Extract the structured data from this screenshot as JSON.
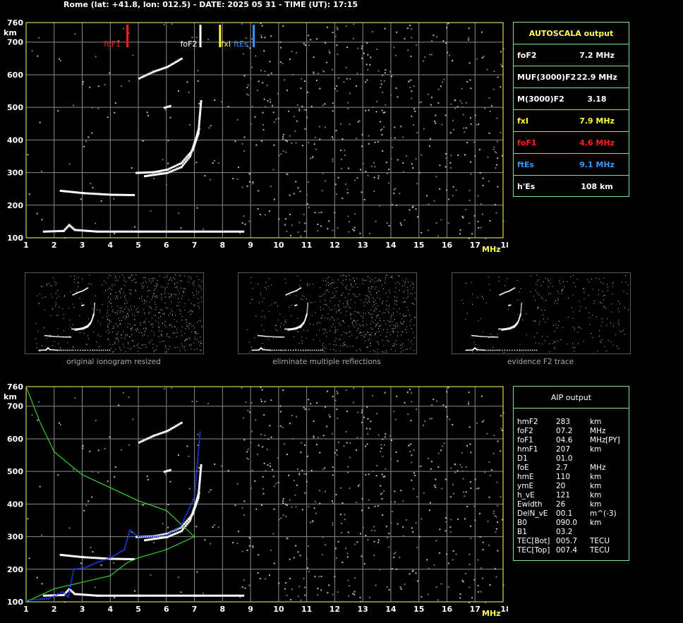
{
  "header": "Rome (lat: +41.8, lon: 012.5) - DATE: 2025 05 31 - TIME (UT): 17:15",
  "axes": {
    "y_ticks": [
      "760",
      "700",
      "600",
      "500",
      "400",
      "300",
      "200",
      "100"
    ],
    "y_unit": "km",
    "x_ticks": [
      "1",
      "2",
      "3",
      "4",
      "5",
      "6",
      "7",
      "8",
      "9",
      "10",
      "11",
      "12",
      "13",
      "14",
      "15",
      "16",
      "17",
      "18"
    ],
    "x_unit": "MHz"
  },
  "markers": [
    {
      "label": "foF1",
      "freq": 4.6,
      "color": "#ff2020"
    },
    {
      "label": "foF2",
      "freq": 7.2,
      "color": "#ffffff"
    },
    {
      "label": "fxI",
      "freq": 7.9,
      "color": "#ffff40"
    },
    {
      "label": "ftEs",
      "freq": 9.1,
      "color": "#3399ff"
    }
  ],
  "autoscala": {
    "title": "AUTOSCALA output",
    "rows": [
      {
        "key": "foF2",
        "value": "7.2 MHz",
        "color": "#ffffff"
      },
      {
        "key": "MUF(3000)F2",
        "value": "22.9 MHz",
        "color": "#ffffff"
      },
      {
        "key": "M(3000)F2",
        "value": "3.18",
        "color": "#ffffff"
      },
      {
        "key": "fxI",
        "value": "7.9 MHz",
        "color": "#ffff40"
      },
      {
        "key": "foF1",
        "value": "4.6 MHz",
        "color": "#ff2020"
      },
      {
        "key": "ftEs",
        "value": "9.1 MHz",
        "color": "#3399ff"
      },
      {
        "key": "h'Es",
        "value": "108     km",
        "color": "#ffffff"
      }
    ]
  },
  "thumbnails": [
    {
      "caption": "original ionogram resized"
    },
    {
      "caption": "eliminate multiple reflections"
    },
    {
      "caption": "evidence F2 trace"
    }
  ],
  "aip": {
    "title": "AIP output",
    "rows": [
      {
        "k": "hmF2",
        "v": "283",
        "u": "km",
        "x": ""
      },
      {
        "k": "foF2",
        "v": "07.2",
        "u": "MHz",
        "x": ""
      },
      {
        "k": "foF1",
        "v": "04.6",
        "u": "MHz",
        "x": "[PY]"
      },
      {
        "k": "hmF1",
        "v": "207",
        "u": "km",
        "x": ""
      },
      {
        "k": "D1",
        "v": "01.0",
        "u": "",
        "x": ""
      },
      {
        "k": "foE",
        "v": "2.7",
        "u": "MHz",
        "x": ""
      },
      {
        "k": "hmE",
        "v": "110",
        "u": "km",
        "x": ""
      },
      {
        "k": "ymE",
        "v": "20",
        "u": "km",
        "x": ""
      },
      {
        "k": "h_vE",
        "v": "121",
        "u": "km",
        "x": ""
      },
      {
        "k": "Ewidth",
        "v": "26",
        "u": "km",
        "x": ""
      },
      {
        "k": "DelN_vE",
        "v": "00.1",
        "u": "m^(-3)",
        "x": ""
      },
      {
        "k": "B0",
        "v": "090.0",
        "u": "km",
        "x": ""
      },
      {
        "k": "B1",
        "v": "03.2",
        "u": "",
        "x": ""
      },
      {
        "k": "TEC[Bot]",
        "v": "005.7",
        "u": "TECU",
        "x": ""
      },
      {
        "k": "TEC[Top]",
        "v": "007.4",
        "u": "TECU",
        "x": ""
      }
    ]
  },
  "chart_data": [
    {
      "type": "scatter",
      "title": "",
      "xlabel": "MHz",
      "ylabel": "km",
      "xlim": [
        1,
        18
      ],
      "ylim": [
        100,
        760
      ],
      "grid": true,
      "series": [
        {
          "values": [
            [
              1.6,
              120
            ],
            [
              2.3,
              122
            ],
            [
              2.5,
              140
            ],
            [
              2.7,
              125
            ],
            [
              3.5,
              120
            ],
            [
              5,
              120
            ],
            [
              7,
              120
            ],
            [
              8.7,
              120
            ]
          ]
        },
        {
          "values": [
            [
              2.2,
              245
            ],
            [
              3,
              238
            ],
            [
              4,
              233
            ],
            [
              4.8,
              232
            ]
          ]
        },
        {
          "values": [
            [
              4.9,
              300
            ],
            [
              5.5,
              302
            ],
            [
              6,
              310
            ],
            [
              6.5,
              330
            ],
            [
              6.9,
              370
            ],
            [
              7.1,
              420
            ],
            [
              7.2,
              520
            ]
          ]
        },
        {
          "values": [
            [
              5.2,
              290
            ],
            [
              6,
              300
            ],
            [
              6.5,
              318
            ],
            [
              6.8,
              350
            ],
            [
              7,
              400
            ],
            [
              7.1,
              430
            ]
          ]
        },
        {
          "values": [
            [
              5,
              590
            ],
            [
              5.5,
              610
            ],
            [
              6,
              625
            ],
            [
              6.5,
              650
            ]
          ]
        },
        {
          "values": [
            [
              5.9,
              500
            ],
            [
              6.1,
              505
            ]
          ]
        }
      ]
    },
    {
      "type": "line",
      "title": "",
      "xlabel": "MHz",
      "ylabel": "km",
      "xlim": [
        1,
        18
      ],
      "ylim": [
        100,
        760
      ],
      "grid": true,
      "series": [
        {
          "values": [
            [
              1,
              760
            ],
            [
              1.5,
              650
            ],
            [
              2,
              560
            ],
            [
              3,
              490
            ],
            [
              4,
              450
            ],
            [
              5,
              410
            ],
            [
              6,
              380
            ],
            [
              7,
              300
            ],
            [
              6,
              260
            ],
            [
              5,
              235
            ],
            [
              4.6,
              220
            ],
            [
              4,
              180
            ],
            [
              3,
              160
            ],
            [
              2,
              140
            ],
            [
              1,
              100
            ]
          ]
        },
        {
          "values": [
            [
              1,
              105
            ],
            [
              1.8,
              110
            ],
            [
              2.3,
              130
            ],
            [
              2.5,
              115
            ],
            [
              2.7,
              200
            ],
            [
              3.1,
              205
            ],
            [
              3.5,
              220
            ],
            [
              4,
              235
            ],
            [
              4.5,
              260
            ],
            [
              4.7,
              320
            ],
            [
              5,
              300
            ],
            [
              5.5,
              300
            ],
            [
              6,
              305
            ],
            [
              6.5,
              330
            ],
            [
              7,
              420
            ],
            [
              7.2,
              620
            ]
          ]
        }
      ]
    }
  ]
}
